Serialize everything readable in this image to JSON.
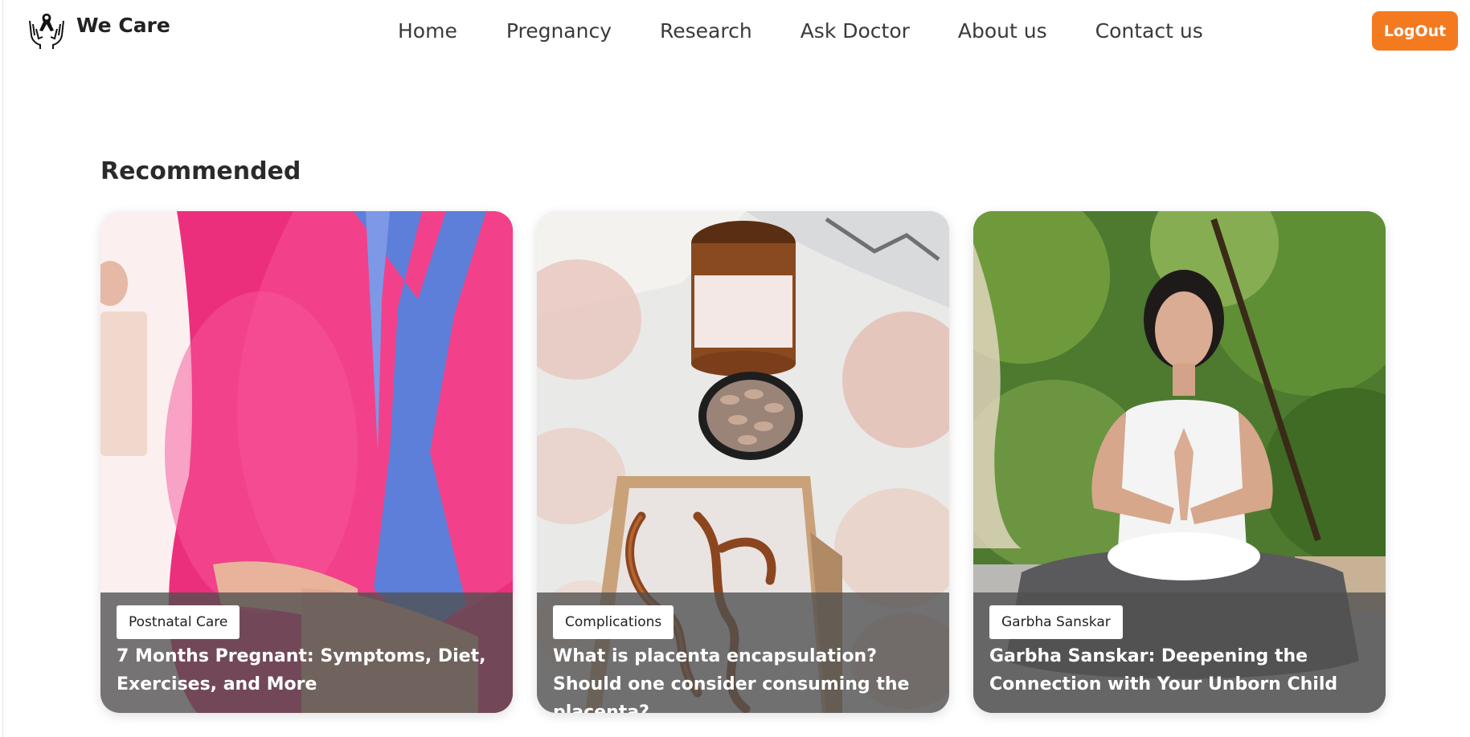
{
  "brand": {
    "name": "We Care",
    "logo_icon": "ribbon-hands-icon"
  },
  "nav": {
    "items": [
      "Home",
      "Pregnancy",
      "Research",
      "Ask Doctor",
      "About us",
      "Contact us"
    ]
  },
  "logout": {
    "label": "LogOut",
    "color": "#f47a20"
  },
  "recommended": {
    "heading": "Recommended",
    "cards": [
      {
        "tag": "Postnatal Care",
        "title": "7 Months Pregnant: Symptoms, Diet, Exercises, and More"
      },
      {
        "tag": "Complications",
        "title": "What is placenta encapsulation? Should one consider consuming the placenta?"
      },
      {
        "tag": "Garbha Sanskar",
        "title": "Garbha Sanskar: Deepening the Connection with Your Unborn Child"
      }
    ]
  }
}
